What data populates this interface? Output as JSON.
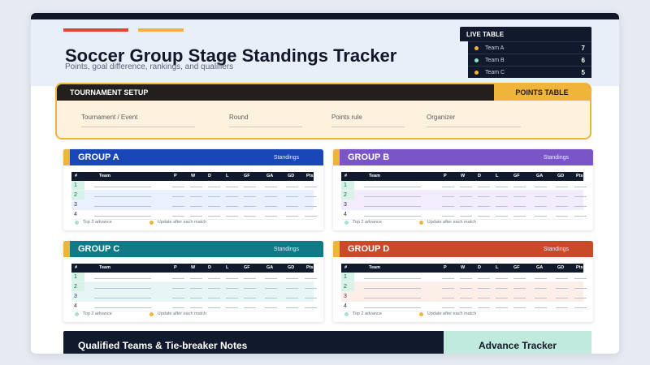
{
  "header": {
    "title": "Soccer Group Stage Standings Tracker",
    "subtitle": "Points, goal difference, rankings, and qualifiers",
    "accent_colors": [
      "#e0443a",
      "#f1b43a"
    ]
  },
  "live_table": {
    "title": "LIVE TABLE",
    "rows": [
      {
        "team": "Team A",
        "points": "7",
        "dot_color": "#f1b43a"
      },
      {
        "team": "Team B",
        "points": "6",
        "dot_color": "#8ee0c2"
      },
      {
        "team": "Team C",
        "points": "5",
        "dot_color": "#f1b43a"
      }
    ]
  },
  "setup": {
    "title": "TOURNAMENT SETUP",
    "points_tab": "POINTS TABLE",
    "fields": [
      "Tournament / Event",
      "Round",
      "Points rule",
      "Organizer"
    ]
  },
  "table_columns": [
    "#",
    "Team",
    "P",
    "W",
    "D",
    "L",
    "GF",
    "GA",
    "GD",
    "Pts"
  ],
  "groups": [
    {
      "name": "GROUP A",
      "tag": "Standings",
      "color": "#1a47b8",
      "tint": "#e9f1ff",
      "rows": [
        "1",
        "2",
        "3",
        "4"
      ]
    },
    {
      "name": "GROUP B",
      "tag": "Standings",
      "color": "#7a55c7",
      "tint": "#f2ecfc",
      "rows": [
        "1",
        "2",
        "3",
        "4"
      ]
    },
    {
      "name": "GROUP C",
      "tag": "Standings",
      "color": "#117a86",
      "tint": "#e5f6f5",
      "rows": [
        "1",
        "2",
        "3",
        "4"
      ]
    },
    {
      "name": "GROUP D",
      "tag": "Standings",
      "color": "#c94a2a",
      "tint": "#fdeee8",
      "rows": [
        "1",
        "2",
        "3",
        "4"
      ]
    }
  ],
  "legend": {
    "advance": "Top 2 advance",
    "update": "Update after each match",
    "advance_color": "#a6e3cf",
    "update_color": "#f1b43a"
  },
  "footer": {
    "notes_title": "Qualified Teams & Tie-breaker Notes",
    "tracker_title": "Advance Tracker"
  }
}
